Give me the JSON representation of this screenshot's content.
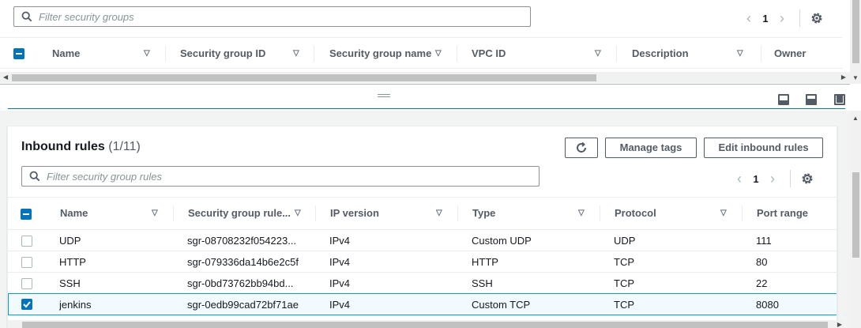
{
  "top": {
    "search_placeholder": "Filter security groups",
    "page_number": "1",
    "columns": [
      {
        "label": "Name"
      },
      {
        "label": "Security group ID"
      },
      {
        "label": "Security group name"
      },
      {
        "label": "VPC ID"
      },
      {
        "label": "Description"
      },
      {
        "label": "Owner"
      }
    ]
  },
  "inbound": {
    "title": "Inbound rules",
    "count": "(1/11)",
    "buttons": {
      "refresh_icon": "refresh-icon",
      "manage_tags": "Manage tags",
      "edit_inbound_rules": "Edit inbound rules"
    },
    "search_placeholder": "Filter security group rules",
    "page_number": "1",
    "columns": [
      {
        "label": "Name"
      },
      {
        "label": "Security group rule..."
      },
      {
        "label": "IP version"
      },
      {
        "label": "Type"
      },
      {
        "label": "Protocol"
      },
      {
        "label": "Port range"
      }
    ],
    "rows": [
      {
        "name": "UDP",
        "rule_id": "sgr-08708232f054223...",
        "ip_version": "IPv4",
        "type": "Custom UDP",
        "protocol": "UDP",
        "port_range": "111",
        "selected": false
      },
      {
        "name": "HTTP",
        "rule_id": "sgr-079336da14b6e2c5f",
        "ip_version": "IPv4",
        "type": "HTTP",
        "protocol": "TCP",
        "port_range": "80",
        "selected": false
      },
      {
        "name": "SSH",
        "rule_id": "sgr-0bd73762bb94bd...",
        "ip_version": "IPv4",
        "type": "SSH",
        "protocol": "TCP",
        "port_range": "22",
        "selected": false
      },
      {
        "name": "jenkins",
        "rule_id": "sgr-0edb99cad72bf71ae",
        "ip_version": "IPv4",
        "type": "Custom TCP",
        "protocol": "TCP",
        "port_range": "8080",
        "selected": true
      }
    ]
  },
  "colors": {
    "accent": "#0073bb",
    "selected_row_bg": "#f1faff",
    "selected_row_border": "#00a1c9"
  }
}
